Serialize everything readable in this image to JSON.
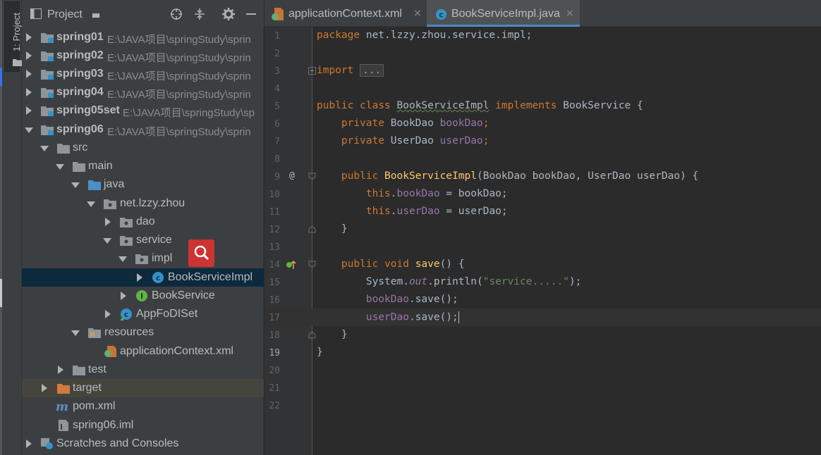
{
  "sidebar_stripe": {
    "label": "1: Project"
  },
  "project_panel": {
    "title": "Project",
    "tree": [
      {
        "name": "spring01",
        "path": "E:\\JAVA项目\\springStudy\\sprin"
      },
      {
        "name": "spring02",
        "path": "E:\\JAVA项目\\springStudy\\sprin"
      },
      {
        "name": "spring03",
        "path": "E:\\JAVA项目\\springStudy\\sprin"
      },
      {
        "name": "spring04",
        "path": "E:\\JAVA项目\\springStudy\\sprin"
      },
      {
        "name": "spring05set",
        "path": "E:\\JAVA项目\\springStudy\\sp"
      },
      {
        "name": "spring06",
        "path": "E:\\JAVA项目\\springStudy\\sprin"
      },
      {
        "name": "src"
      },
      {
        "name": "main"
      },
      {
        "name": "java"
      },
      {
        "name": "net.lzzy.zhou"
      },
      {
        "name": "dao"
      },
      {
        "name": "service"
      },
      {
        "name": "impl"
      },
      {
        "name": "BookServiceImpl"
      },
      {
        "name": "BookService"
      },
      {
        "name": "AppFoDISet"
      },
      {
        "name": "resources"
      },
      {
        "name": "applicationContext.xml"
      },
      {
        "name": "test"
      },
      {
        "name": "target"
      },
      {
        "name": "pom.xml"
      },
      {
        "name": "spring06.iml"
      },
      {
        "name": "Scratches and Consoles"
      }
    ],
    "selected": "BookServiceImpl"
  },
  "editor": {
    "tabs": [
      {
        "label": "applicationContext.xml",
        "close": "×"
      },
      {
        "label": "BookServiceImpl.java",
        "close": "×",
        "active": true
      }
    ],
    "line_numbers": [
      "1",
      "2",
      "3",
      "4",
      "5",
      "6",
      "7",
      "8",
      "9",
      "10",
      "11",
      "12",
      "13",
      "14",
      "15",
      "16",
      "17",
      "18",
      "19",
      "20",
      "21",
      "22"
    ],
    "current_line": "19",
    "code": {
      "l1_kw": "package",
      "l1_rest": " net.lzzy.zhou.service.impl;",
      "l3_kw": "import",
      "l3_fold": "...",
      "l5_public": "public",
      "l5_class": "class",
      "l5_name": "BookServiceImpl",
      "l5_implements": "implements",
      "l5_rest": " BookService {",
      "private": "private",
      "l6_type": " BookDao ",
      "l6_field": "bookDao",
      "l7_type": " UserDao ",
      "l7_field": "userDao",
      "semicolon": ";",
      "l9_public": "public",
      "l9_name": "BookServiceImpl",
      "l9_params": "(BookDao bookDao, UserDao userDao) {",
      "this": "this",
      "dot": ".",
      "l10_field": "bookDao",
      "l10_rest": " = bookDao;",
      "l11_field": "userDao",
      "l11_rest": " = userDao;",
      "close_brace": "}",
      "l14_public": "public",
      "l14_void": "void",
      "l14_name": "save",
      "l14_rest": "() {",
      "l15_sys": "System.",
      "l15_out": "out",
      "l15_println": ".println(",
      "l15_str": "\"service.....\"",
      "l15_end": ");",
      "l16_field": "bookDao",
      "l16_rest": ".save();",
      "l17_field": "userDao",
      "l17_rest": ".save();",
      "override_marker": "@"
    }
  },
  "colors": {
    "keyword": "#cc7832",
    "field": "#9876aa",
    "method": "#ffc66d",
    "string": "#6a8759",
    "text": "#a9b7c6",
    "selection": "#0d293e",
    "accent": "#4a88c7"
  },
  "icons": [
    "project-folder-icon",
    "locate-icon",
    "collapse-icon",
    "gear-icon",
    "minimize-icon",
    "module-icon",
    "folder-icon",
    "package-icon",
    "class-icon",
    "interface-icon",
    "spring-xml-icon",
    "maven-icon",
    "iml-icon",
    "scratches-icon",
    "search-icon"
  ]
}
